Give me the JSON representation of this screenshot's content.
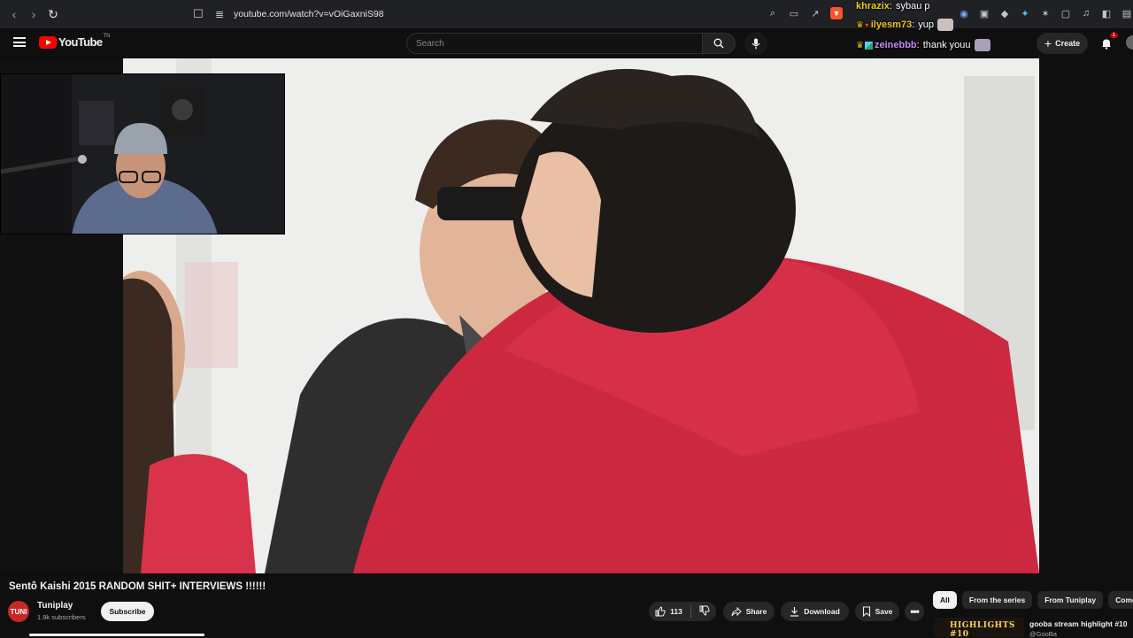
{
  "browser": {
    "url": "youtube.com/watch?v=vOiGaxniS98"
  },
  "chat": [
    {
      "user": "khrazix",
      "message": "sybau p",
      "color": "#e8d21a"
    },
    {
      "user": "ilyesm73",
      "message": "yup",
      "color": "#f0c419"
    },
    {
      "user": "zeinebbb",
      "message": "thank youu",
      "color": "#c987f7"
    }
  ],
  "header": {
    "logo_text": "YouTube",
    "logo_tm": "TN",
    "search_placeholder": "Search",
    "create_label": "Create",
    "notification_count": "1"
  },
  "video": {
    "title": "Sentô Kaishi 2015 RANDOM SHIT+ INTERVIEWS !!!!!!"
  },
  "channel": {
    "name": "Tuniplay",
    "subscribers": "1.9k subscribers",
    "avatar_text": "TUNI",
    "subscribe_label": "Subscribe"
  },
  "actions": {
    "likes": "113",
    "share_label": "Share",
    "download_label": "Download",
    "save_label": "Save"
  },
  "chips": [
    "All",
    "From the series",
    "From Tuniplay",
    "Comed"
  ],
  "recommendation": {
    "thumb_text": "HIGHLIGHTS #10",
    "title": "gooba stream highlight #10",
    "channel": "@GooBa"
  },
  "colors": {
    "accent_red": "#ff0000",
    "background": "#0f0f0f",
    "brave_orange": "#fb542b"
  }
}
